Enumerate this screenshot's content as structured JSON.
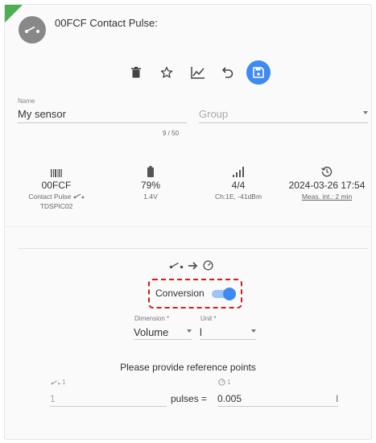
{
  "header": {
    "title": "00FCF Contact Pulse:"
  },
  "toolbar": {
    "delete_icon": "trash-icon",
    "favorite_icon": "star-icon",
    "chart_icon": "line-chart-icon",
    "undo_icon": "undo-icon",
    "save_icon": "floppy-disk-icon"
  },
  "form": {
    "name_label": "Name",
    "name_value": "My sensor",
    "name_char_count": "9 / 50",
    "group_placeholder": "Group"
  },
  "stats": {
    "id": {
      "icon": "barcode-icon",
      "main": "00FCF",
      "sub1": "Contact Pulse",
      "sub2": "TDSPIC02"
    },
    "battery": {
      "icon": "battery-icon",
      "main": "79%",
      "sub": "1.4V"
    },
    "signal": {
      "icon": "signal-icon",
      "main": "4/4",
      "sub": "Ch:1E, -41dBm"
    },
    "time": {
      "icon": "history-icon",
      "main": "2024-03-26 17:54",
      "sub": "Meas. int.: 2 min"
    }
  },
  "conversion": {
    "label": "Conversion",
    "enabled": true,
    "dimension_label": "Dimension *",
    "dimension_value": "Volume",
    "unit_label": "Unit *",
    "unit_value": "l"
  },
  "reference": {
    "title": "Please provide reference points",
    "left_header_index": "1",
    "left_value": "1",
    "right_header_index": "1",
    "pulses_label": "pulses =",
    "right_value": "0.005",
    "right_unit": "l"
  },
  "colors": {
    "accent": "#3d8bf2",
    "corner_flag": "#4caf50",
    "highlight": "#cc2020"
  }
}
